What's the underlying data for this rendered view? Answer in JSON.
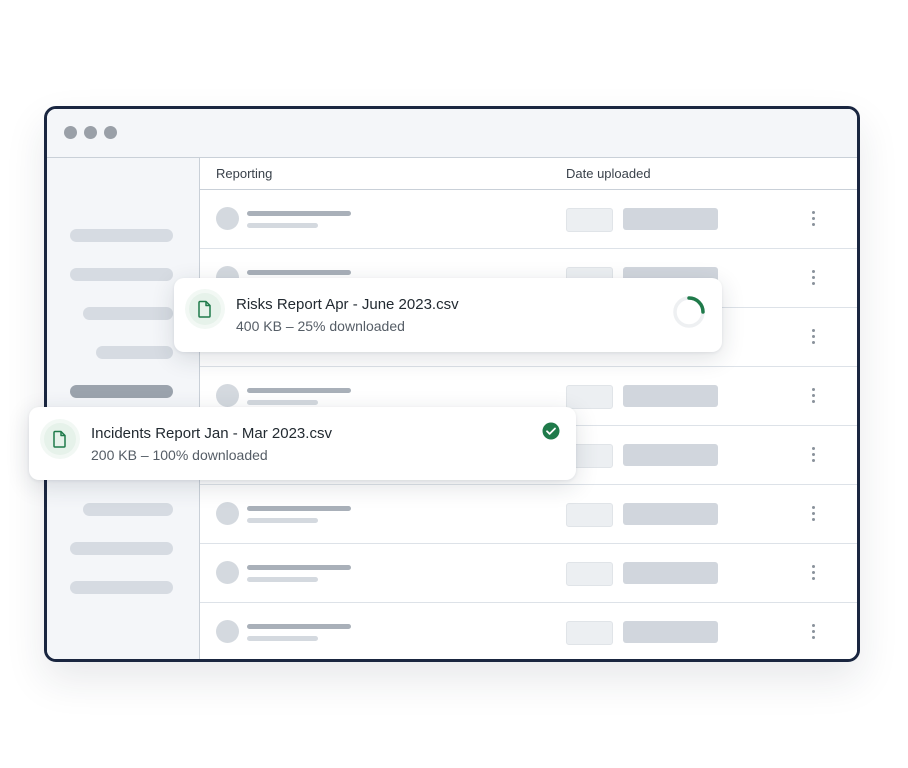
{
  "table": {
    "col_reporting": "Reporting",
    "col_date_uploaded": "Date uploaded"
  },
  "toasts": {
    "risks": {
      "filename": "Risks Report Apr - June 2023.csv",
      "status": "400 KB – 25% downloaded",
      "progress_percent": 25,
      "state": "downloading"
    },
    "incidents": {
      "filename": "Incidents Report Jan - Mar 2023.csv",
      "status": "200 KB – 100% downloaded",
      "progress_percent": 100,
      "state": "complete"
    }
  },
  "colors": {
    "accent_green": "#1f7a4a",
    "window_border": "#1a2640"
  },
  "icons": {
    "file": "file-icon",
    "spinner": "progress-spinner-icon",
    "check": "check-circle-icon",
    "menu": "kebab-menu-icon"
  }
}
